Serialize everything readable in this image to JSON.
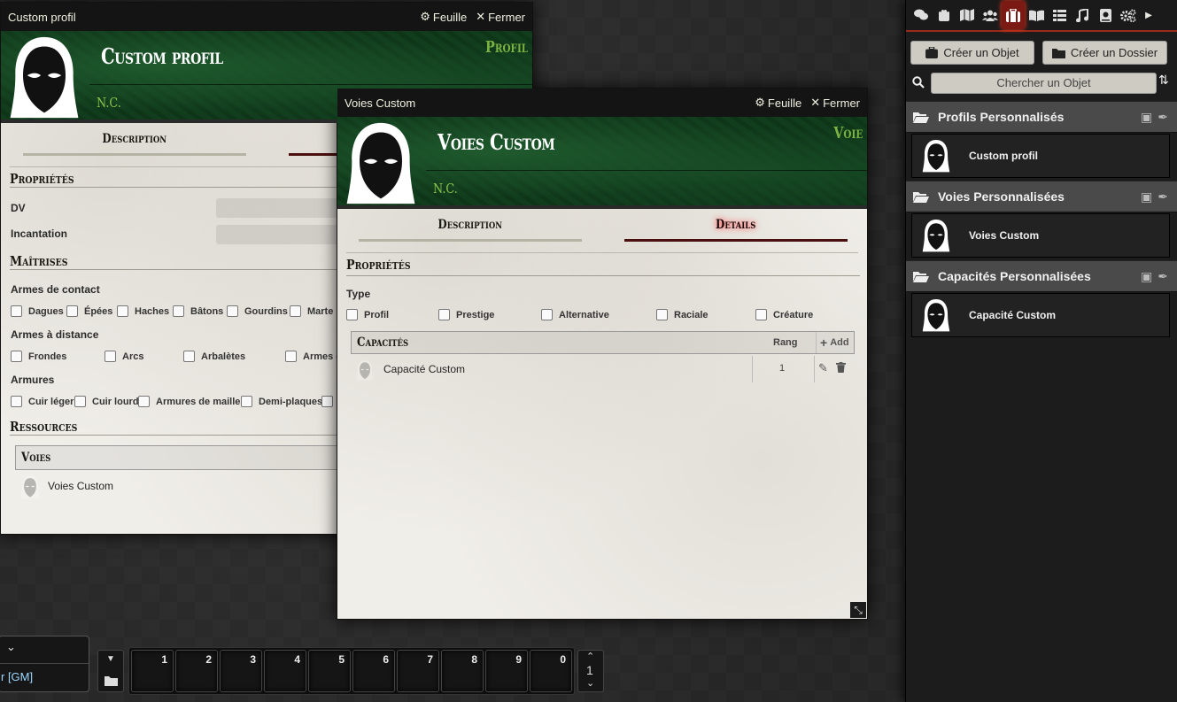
{
  "win_profil": {
    "titlebar": "Custom profil",
    "sheet_btn": "Feuille",
    "close_btn": "Fermer",
    "name": "Custom profil",
    "type": "Profil",
    "nc": "N.C.",
    "tab_description": "Description",
    "section_proprietes": "Propriétés",
    "label_dv": "DV",
    "label_incantation": "Incantation",
    "section_maitrises": "Maîtrises",
    "label_armes_contact": "Armes de contact",
    "armes_contact": [
      "Dagues",
      "Épées",
      "Haches",
      "Bâtons",
      "Gourdins",
      "Marte"
    ],
    "label_armes_distance": "Armes à distance",
    "armes_distance": [
      "Frondes",
      "Arcs",
      "Arbalètes",
      "Armes d"
    ],
    "label_armures": "Armures",
    "armures": [
      "Cuir léger",
      "Cuir lourd",
      "Armures de mailles",
      "Demi-plaques"
    ],
    "section_ressources": "Ressources",
    "voies_header": "Voies",
    "voie_item": "Voies Custom"
  },
  "win_voies": {
    "titlebar": "Voies Custom",
    "sheet_btn": "Feuille",
    "close_btn": "Fermer",
    "name": "Voies Custom",
    "type": "Voie",
    "nc": "N.C.",
    "tab_description": "Description",
    "tab_details": "Details",
    "section_proprietes": "Propriétés",
    "label_type": "Type",
    "types": [
      "Profil",
      "Prestige",
      "Alternative",
      "Raciale",
      "Créature"
    ],
    "capacites_header": "Capacités",
    "rang_header": "Rang",
    "add_label": "Add",
    "capacite_name": "Capacité Custom",
    "capacite_rang": "1"
  },
  "sidebar": {
    "create_item": "Créer un Objet",
    "create_folder": "Créer un Dossier",
    "search_placeholder": "Chercher un Objet",
    "folders": [
      {
        "label": "Profils Personnalisés",
        "entry": "Custom profil"
      },
      {
        "label": "Voies Personnalisées",
        "entry": "Voies Custom"
      },
      {
        "label": "Capacités Personnalisées",
        "entry": "Capacité Custom"
      }
    ]
  },
  "players": {
    "gm_label": "r [GM]"
  },
  "hotbar": {
    "slots": [
      "1",
      "2",
      "3",
      "4",
      "5",
      "6",
      "7",
      "8",
      "9",
      "0"
    ],
    "page": "1"
  }
}
